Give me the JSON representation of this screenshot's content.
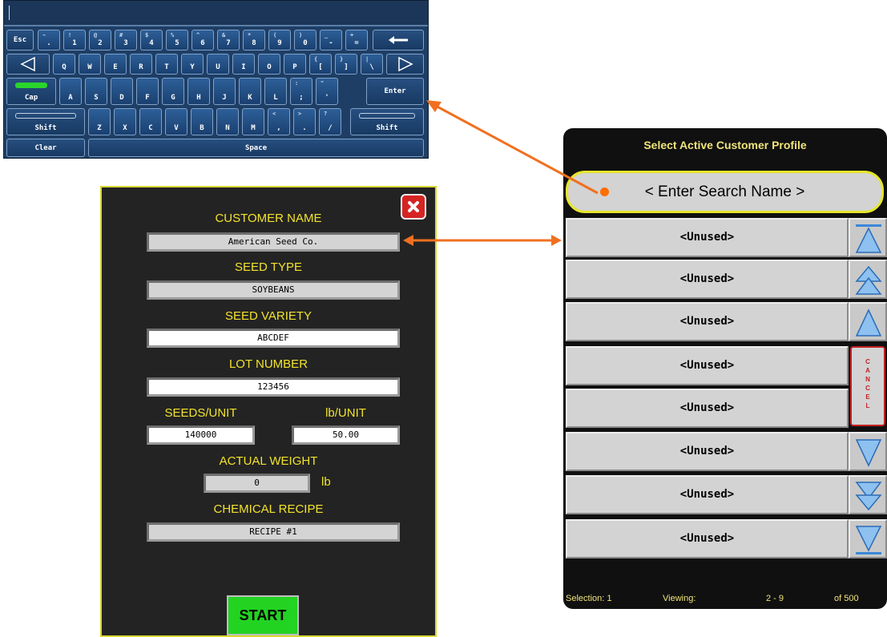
{
  "keyboard": {
    "row1": [
      {
        "main": "Esc",
        "shift": "",
        "kind": "fn"
      },
      {
        "main": ".",
        "shift": "~"
      },
      {
        "main": "1",
        "shift": "!"
      },
      {
        "main": "2",
        "shift": "@"
      },
      {
        "main": "3",
        "shift": "#"
      },
      {
        "main": "4",
        "shift": "$"
      },
      {
        "main": "5",
        "shift": "%"
      },
      {
        "main": "6",
        "shift": "^"
      },
      {
        "main": "7",
        "shift": "&"
      },
      {
        "main": "8",
        "shift": "*"
      },
      {
        "main": "9",
        "shift": "("
      },
      {
        "main": "0",
        "shift": ")"
      },
      {
        "main": "-",
        "shift": "_"
      },
      {
        "main": "=",
        "shift": "+"
      }
    ],
    "backspace_icon": "left-arrow-icon",
    "row2": [
      "Q",
      "W",
      "E",
      "R",
      "T",
      "Y",
      "U",
      "I",
      "O",
      "P",
      "[",
      "]",
      "\\"
    ],
    "row2_shift": [
      "",
      "",
      "",
      "",
      "",
      "",
      "",
      "",
      "",
      "",
      "{",
      "}",
      "|"
    ],
    "left_icon": "triangle-left-icon",
    "right_icon": "triangle-right-icon",
    "row3": [
      "A",
      "S",
      "D",
      "F",
      "G",
      "H",
      "J",
      "K",
      "L",
      ";",
      "'"
    ],
    "row3_shift": [
      "",
      "",
      "",
      "",
      "",
      "",
      "",
      "",
      "",
      ":",
      "\""
    ],
    "cap_label": "Cap",
    "enter_label": "Enter",
    "row4": [
      "Z",
      "X",
      "C",
      "V",
      "B",
      "N",
      "M",
      ",",
      ".",
      "/"
    ],
    "row4_shift": [
      "",
      "",
      "",
      "",
      "",
      "",
      "",
      "<",
      ">",
      "?"
    ],
    "shift_left_label": "Shift",
    "shift_right_label": "Shift",
    "clear_label": "Clear",
    "space_label": "Space",
    "cap_indicator_color": "#2bd42b"
  },
  "form": {
    "customer_name_label": "CUSTOMER NAME",
    "customer_name_value": "American Seed Co.",
    "seed_type_label": "SEED TYPE",
    "seed_type_value": "SOYBEANS",
    "seed_variety_label": "SEED VARIETY",
    "seed_variety_value": "ABCDEF",
    "lot_number_label": "LOT NUMBER",
    "lot_number_value": "123456",
    "seeds_per_unit_label": "SEEDS/UNIT",
    "seeds_per_unit_value": "140000",
    "lb_per_unit_label": "lb/UNIT",
    "lb_per_unit_value": "50.00",
    "actual_weight_label": "ACTUAL WEIGHT",
    "actual_weight_value": "0",
    "actual_weight_unit": "lb",
    "chemical_recipe_label": "CHEMICAL RECIPE",
    "chemical_recipe_value": "RECIPE #1",
    "start_label": "START",
    "close_icon": "close-icon",
    "label_color": "#f2e32c",
    "border_color": "#d8d832",
    "start_color": "#22d322"
  },
  "panel": {
    "title": "Select Active Customer Profile",
    "search_placeholder": "< Enter Search Name >",
    "rows": [
      "<Unused>",
      "<Unused>",
      "<Unused>",
      "<Unused>",
      "<Unused>",
      "<Unused>",
      "<Unused>",
      "<Unused>"
    ],
    "side_buttons": [
      "scroll-top-icon",
      "page-up-icon",
      "line-up-icon",
      "cancel-button",
      "line-down-icon",
      "page-down-icon",
      "scroll-bottom-icon"
    ],
    "cancel_letters": [
      "C",
      "A",
      "N",
      "C",
      "E",
      "L"
    ],
    "status_selection": "Selection: 1",
    "status_viewing": "Viewing:",
    "status_range": "2 - 9",
    "status_total": "of 500",
    "title_color": "#f0e47a",
    "highlight_color": "#e6e62a"
  },
  "annotation_color": "#f07020"
}
